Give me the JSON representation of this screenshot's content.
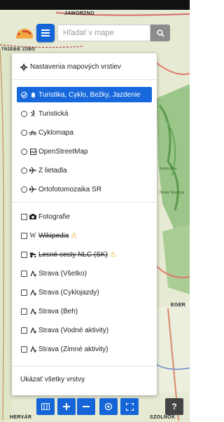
{
  "map": {
    "labels": [
      "JAWORZNO",
      "TRZEBIE ZOBO",
      "Koliechov",
      "Nowa Szekcja",
      "EGER",
      "HERVÁR",
      "SZOLNOK"
    ]
  },
  "search": {
    "placeholder": "Hľadať v mape"
  },
  "panel": {
    "settings_label": "Nastavenia mapových vrstiev",
    "base_layers": [
      {
        "label": "Turistika, Cyklo, Bežky, Jazdenie",
        "icon": "bell-icon",
        "selected": true
      },
      {
        "label": "Turistická",
        "icon": "hiker-icon",
        "selected": false
      },
      {
        "label": "Cyklomapa",
        "icon": "bicycle-icon",
        "selected": false
      },
      {
        "label": "OpenStreetMap",
        "icon": "map-icon",
        "selected": false
      },
      {
        "label": "Z lietadla",
        "icon": "plane-icon",
        "selected": false
      },
      {
        "label": "Ortofotomozaika SR",
        "icon": "plane-icon",
        "selected": false
      }
    ],
    "overlays": [
      {
        "label": "Fotografie",
        "icon": "camera-icon",
        "strike": false,
        "warning": false
      },
      {
        "label": "Wikipedia",
        "icon": "wikipedia-icon",
        "strike": true,
        "warning": true
      },
      {
        "label": "Lesné cesty NLC (SK)",
        "icon": "tractor-icon",
        "strike": true,
        "warning": true
      },
      {
        "label": "Strava (Všetko)",
        "icon": "strava-icon",
        "strike": false,
        "warning": false
      },
      {
        "label": "Strava (Cyklojazdy)",
        "icon": "strava-icon",
        "strike": false,
        "warning": false
      },
      {
        "label": "Strava (Beh)",
        "icon": "strava-icon",
        "strike": false,
        "warning": false
      },
      {
        "label": "Strava (Vodné aktivity)",
        "icon": "strava-icon",
        "strike": false,
        "warning": false
      },
      {
        "label": "Strava (Zimné aktivity)",
        "icon": "strava-icon",
        "strike": false,
        "warning": false
      }
    ],
    "show_all_label": "Ukázať všetky vrstvy"
  },
  "toolbar": {
    "buttons": [
      "layers-icon",
      "plus-icon",
      "minus-icon",
      "locate-icon",
      "fullscreen-icon",
      "help-icon"
    ],
    "help_label": "?"
  },
  "colors": {
    "accent": "#1565d8",
    "selected_row": "#1668dc",
    "warning": "#f0a000"
  }
}
